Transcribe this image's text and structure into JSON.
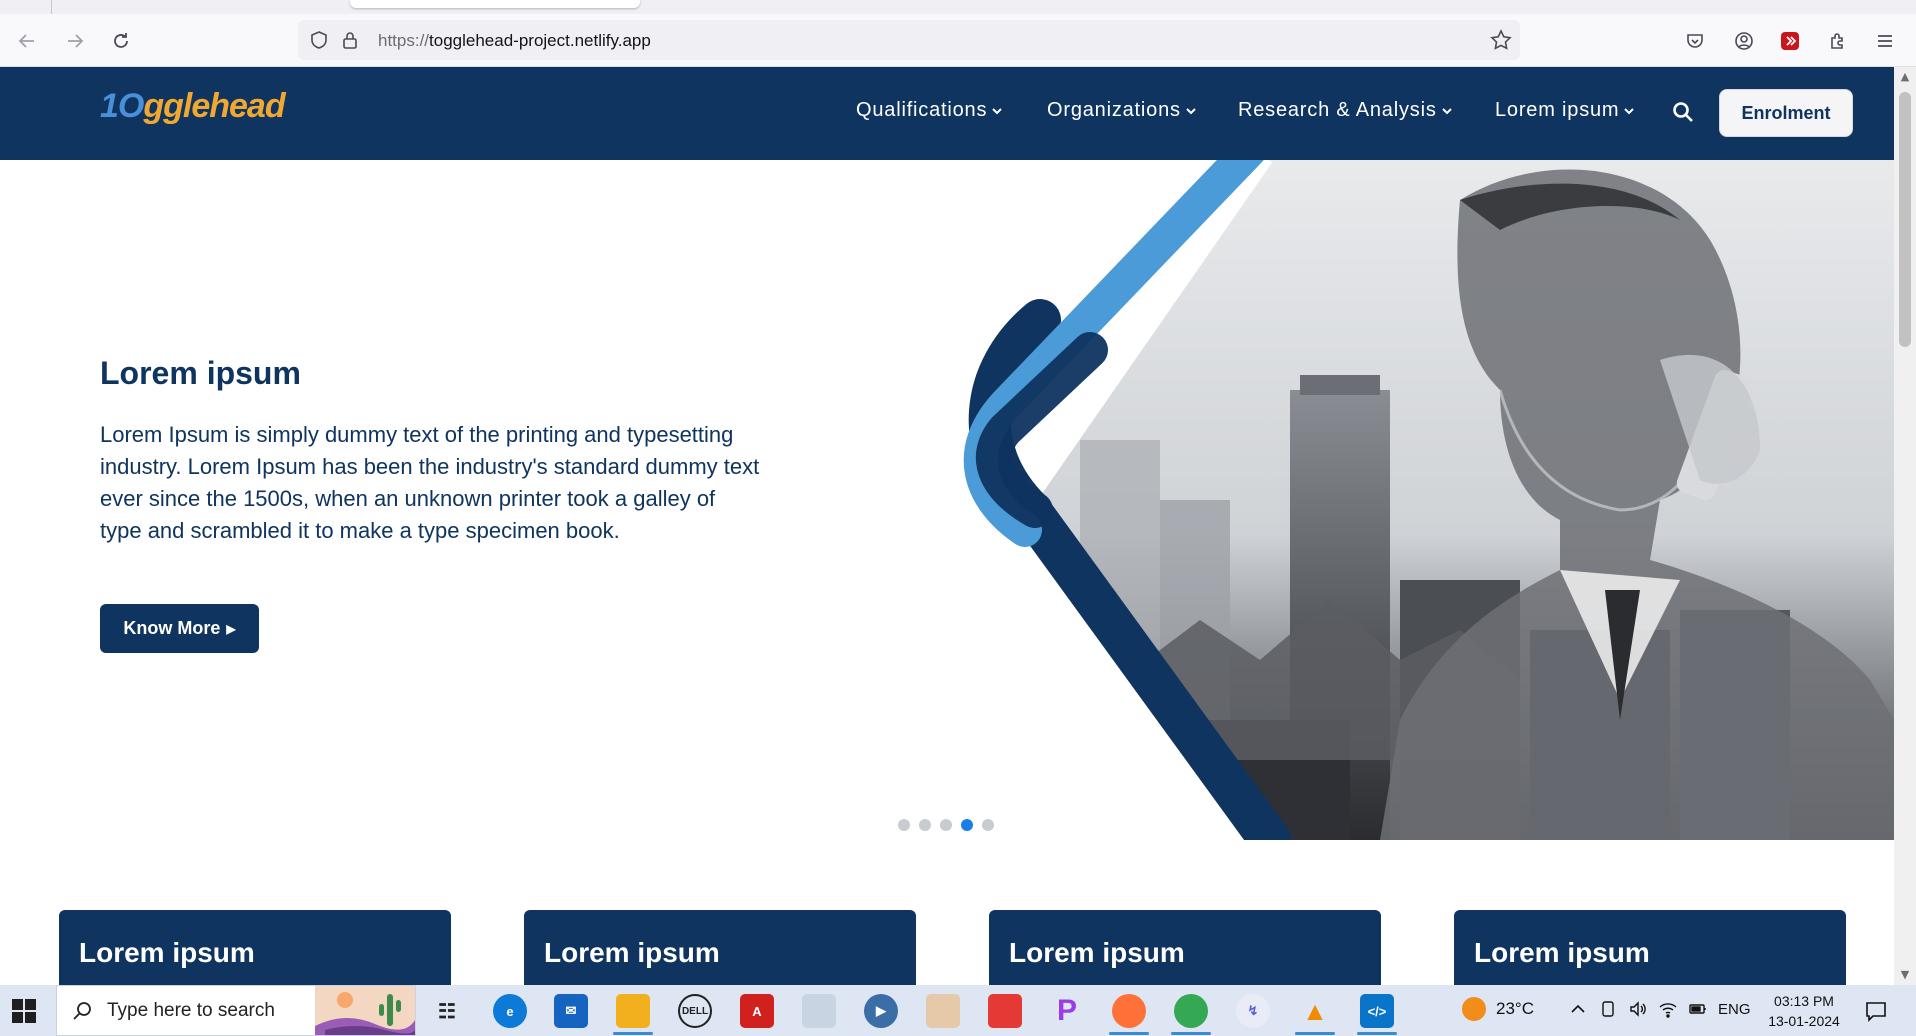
{
  "browser": {
    "url_protocol": "https://",
    "url_host": "togglehead-project.netlify.app",
    "icons": [
      "back-icon",
      "forward-icon",
      "reload-icon",
      "shield-icon",
      "lock-icon",
      "star-icon",
      "pocket-icon",
      "account-icon",
      "extension-red-icon",
      "extensions-icon",
      "menu-icon"
    ]
  },
  "site": {
    "logo_part1": "1O",
    "logo_part2": "gglehead",
    "nav": [
      {
        "label": "Qualifications"
      },
      {
        "label": "Organizations"
      },
      {
        "label": "Research & Analysis"
      },
      {
        "label": "Lorem ipsum"
      }
    ],
    "enrol_label": "Enrolment",
    "colors": {
      "primary": "#0f3460",
      "accent": "#4a9bd8",
      "logo_orange": "#f0a830",
      "dot_active": "#1a7ee8"
    }
  },
  "hero": {
    "title": "Lorem ipsum",
    "text": "Lorem Ipsum is simply dummy text of the printing and typesetting industry. Lorem Ipsum has been the industry's standard dummy text ever since the 1500s, when an unknown printer took a galley of type and scrambled it to make a type specimen book.",
    "button_label": "Know More",
    "dots_total": 5,
    "dot_active_index": 4
  },
  "cards": [
    {
      "title": "Lorem ipsum"
    },
    {
      "title": "Lorem ipsum"
    },
    {
      "title": "Lorem ipsum"
    },
    {
      "title": "Lorem ipsum"
    }
  ],
  "taskbar": {
    "search_placeholder": "Type here to search",
    "weather_temp": "23°C",
    "language": "ENG",
    "time": "03:13 PM",
    "date": "13-01-2024",
    "apps": [
      "task-view",
      "edge",
      "mail",
      "file-explorer",
      "dell",
      "acrobat",
      "app-misc",
      "media",
      "paint",
      "app-misc2",
      "picsart",
      "firefox",
      "chrome",
      "app-feather",
      "vlc",
      "vscode"
    ]
  }
}
